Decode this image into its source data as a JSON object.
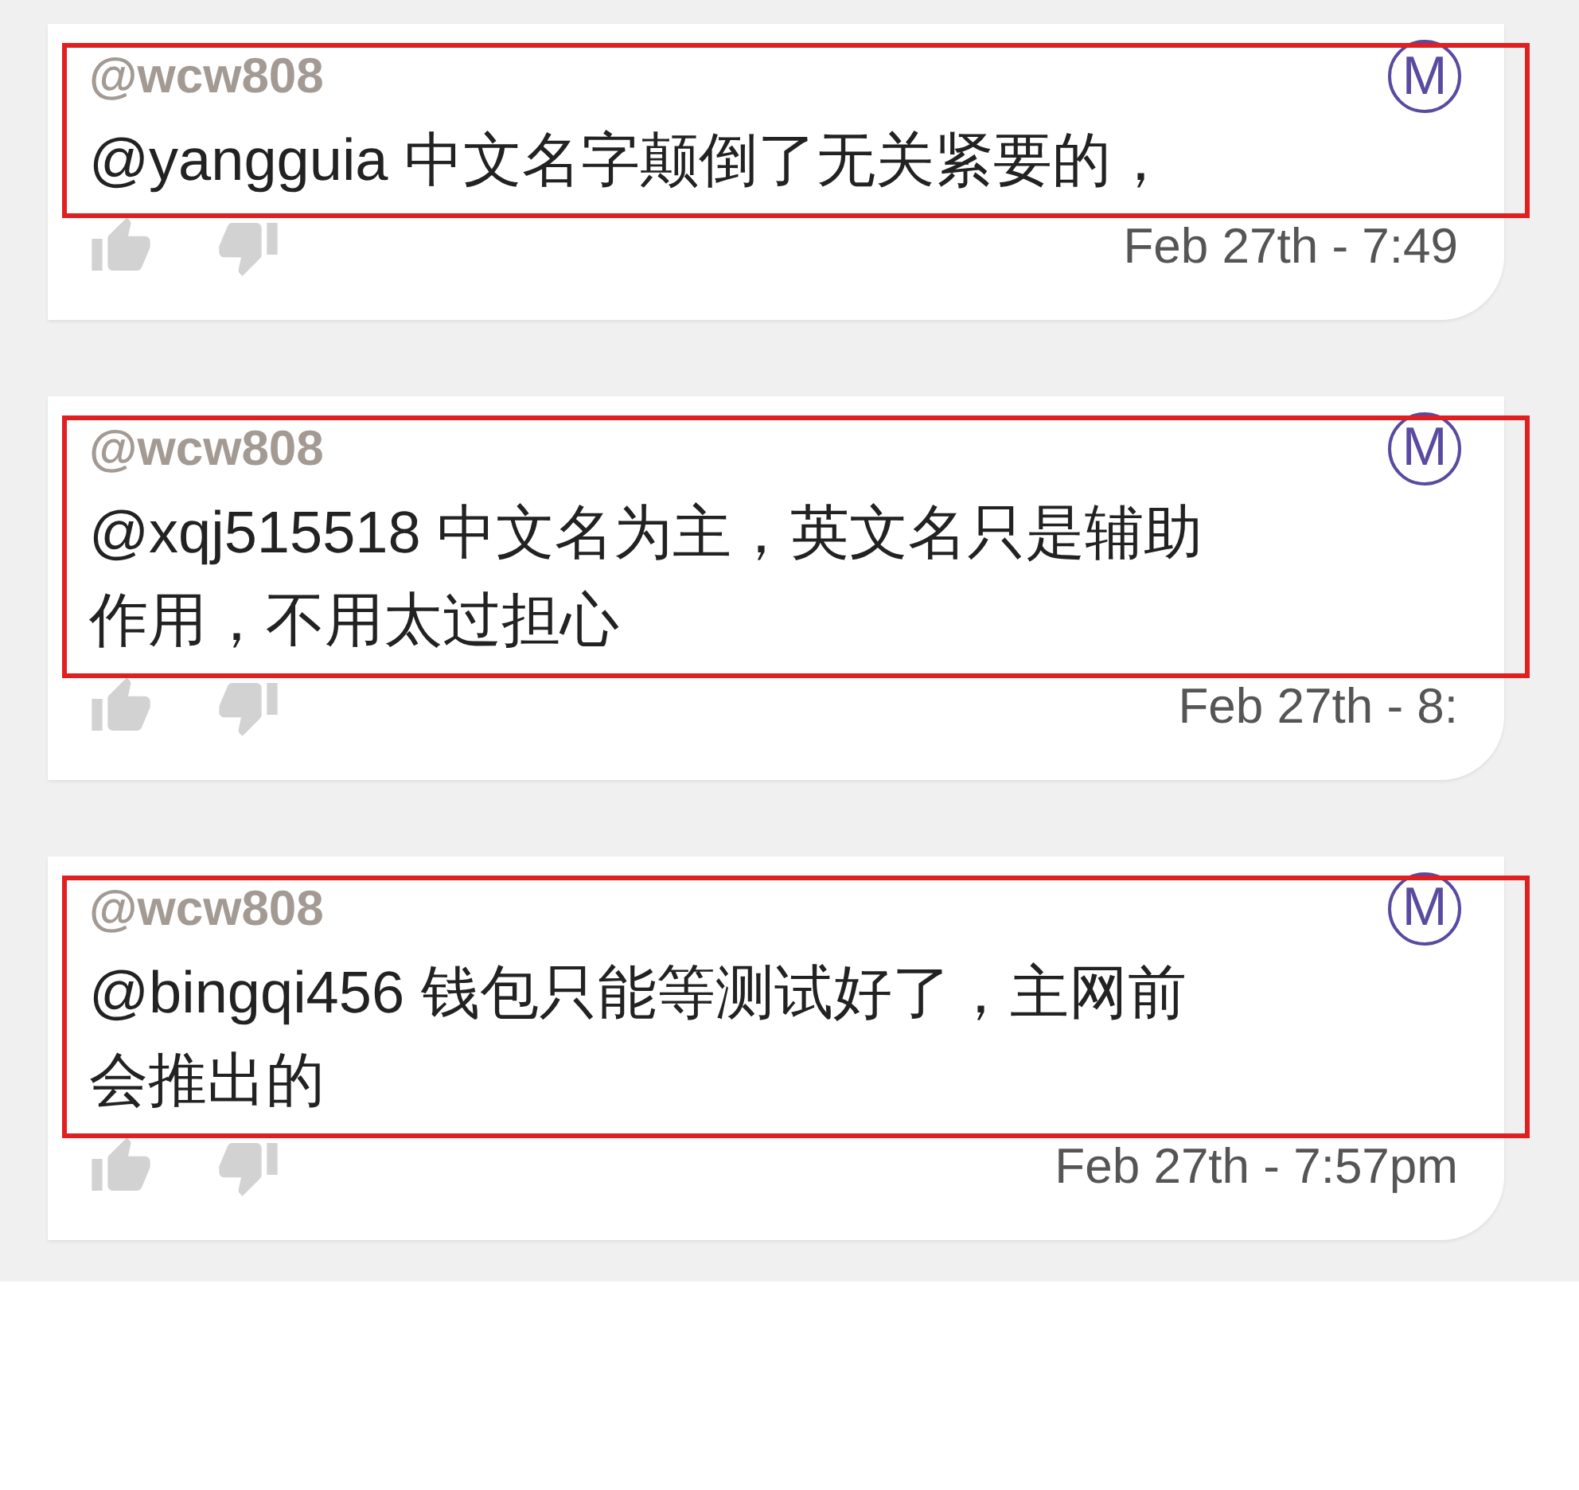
{
  "comments": [
    {
      "author": "@wcw808",
      "badge": "M",
      "text": "@yangguia 中文名字颠倒了无关紧要的，",
      "time": "Feb 27th - 7:49",
      "highlighted": true
    },
    {
      "author": "@wcw808",
      "badge": "M",
      "text": "@xqj515518 中文名为主，英文名只是辅助作用，不用太过担心",
      "time": "Feb 27th - 8:",
      "highlighted": true
    },
    {
      "author": "@wcw808",
      "badge": "M",
      "text": "@bingqi456 钱包只能等测试好了，主网前会推出的",
      "time": "Feb 27th - 7:57pm",
      "highlighted": true
    }
  ]
}
